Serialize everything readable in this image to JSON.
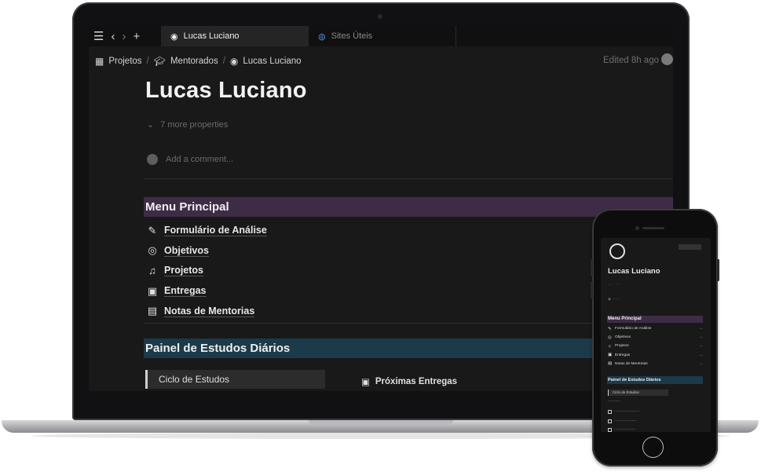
{
  "desktop": {
    "tabs": [
      {
        "label": "Lucas Luciano",
        "icon": "user-circle-icon",
        "active": true
      },
      {
        "label": "Sites Úteis",
        "icon": "globe-icon",
        "active": false
      }
    ],
    "breadcrumb": [
      {
        "label": "Projetos",
        "icon": "calendar-grid-icon"
      },
      {
        "label": "Mentorados",
        "icon": "graduation-cap-icon"
      },
      {
        "label": "Lucas Luciano",
        "icon": "user-circle-icon"
      }
    ],
    "edited": "Edited 8h ago",
    "page_title": "Lucas Luciano",
    "more_properties": "7 more properties",
    "comment_placeholder": "Add a comment...",
    "menu_heading": "Menu Principal",
    "menu_items": [
      {
        "label": "Formulário de Análise",
        "icon": "pencil-icon"
      },
      {
        "label": "Objetivos",
        "icon": "target-icon"
      },
      {
        "label": "Projetos",
        "icon": "music-note-icon"
      },
      {
        "label": "Entregas",
        "icon": "calendar-icon"
      },
      {
        "label": "Notas de Mentorias",
        "icon": "document-icon"
      }
    ],
    "study_heading": "Painel de Estudos Diários",
    "cycle_label": "Ciclo de Estudos",
    "next_deliveries": "Próximas Entregas"
  },
  "mobile": {
    "page_title": "Lucas Luciano",
    "menu_heading": "Menu Principal",
    "menu_items": [
      {
        "label": "Formulário de Análise"
      },
      {
        "label": "Objetivos"
      },
      {
        "label": "Projetos"
      },
      {
        "label": "Entregas"
      },
      {
        "label": "Notas de Mentorias"
      }
    ],
    "study_heading": "Painel de Estudos Diários",
    "cycle_label": "Ciclo de Estudos"
  },
  "colors": {
    "menu_heading_bg": "#3e2c46",
    "study_heading_bg": "#1b3a4a",
    "page_bg": "#191919"
  }
}
